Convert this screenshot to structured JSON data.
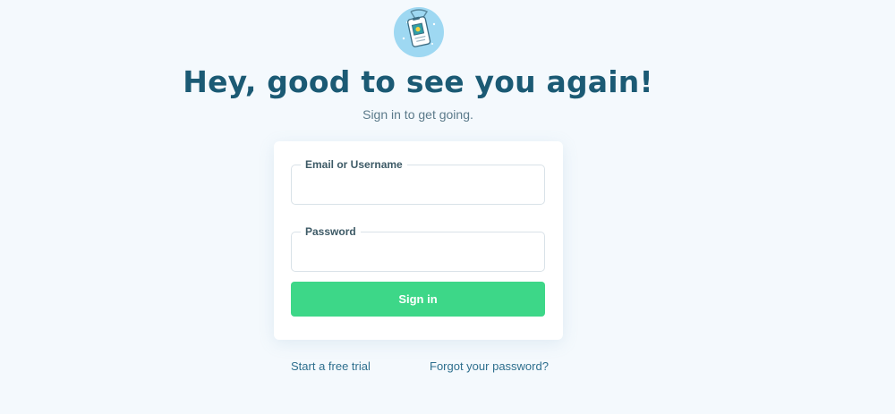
{
  "header": {
    "title": "Hey, good to see you again!",
    "subtitle": "Sign in to get going.",
    "icon": "id-badge-icon"
  },
  "form": {
    "email_label": "Email or Username",
    "email_value": "",
    "password_label": "Password",
    "password_value": "",
    "submit_label": "Sign in"
  },
  "links": {
    "trial": "Start a free trial",
    "forgot": "Forgot your password?"
  },
  "colors": {
    "background": "#f4f9fd",
    "title": "#1b5a74",
    "button": "#3dd788",
    "link": "#2e6f8e"
  }
}
